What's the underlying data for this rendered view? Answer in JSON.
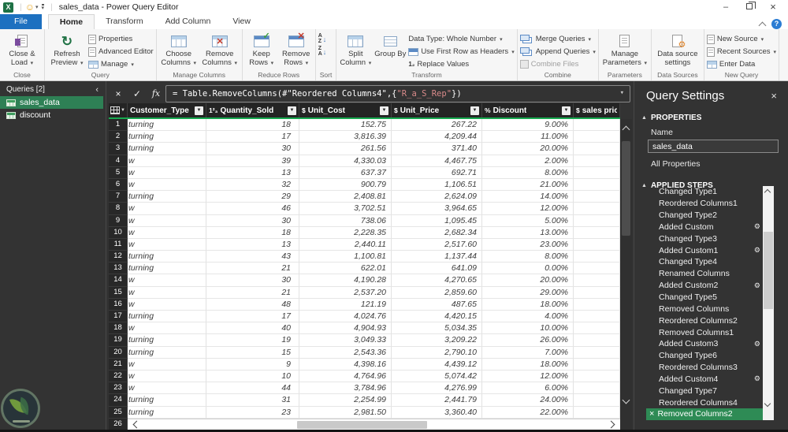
{
  "window": {
    "title": "sales_data - Power Query Editor",
    "excel_logo_letter": "X"
  },
  "icons": {
    "minimize": "–",
    "close": "×",
    "help": "?",
    "smiley": "☺",
    "dropdown": "▾",
    "filter": "▼",
    "cancel": "×",
    "check": "✓",
    "fx": "fx",
    "gear": "⚙",
    "step_delete": "×",
    "queries_collapse": "‹",
    "settings_close": "×",
    "section_triangle": "▲",
    "corner_dropdown": "▼",
    "refresh": "↻",
    "sort_az_letters": "AZ",
    "sort_za_letters": "ZA",
    "sort_arrow": "↓",
    "replace_values_glyph": "1₂"
  },
  "tabs": {
    "file": "File",
    "items": [
      "Home",
      "Transform",
      "Add Column",
      "View"
    ],
    "active": "Home"
  },
  "ribbon": {
    "close_load": "Close & Load",
    "refresh_preview": "Refresh Preview",
    "properties": "Properties",
    "advanced_editor": "Advanced Editor",
    "manage": "Manage",
    "choose_columns": "Choose Columns",
    "remove_columns": "Remove Columns",
    "keep_rows": "Keep Rows",
    "remove_rows": "Remove Rows",
    "split_column": "Split Column",
    "group_by": "Group By",
    "data_type": "Data Type: Whole Number",
    "first_row_headers": "Use First Row as Headers",
    "replace_values": "Replace Values",
    "merge_queries": "Merge Queries",
    "append_queries": "Append Queries",
    "combine_files": "Combine Files",
    "manage_parameters": "Manage Parameters",
    "data_source_settings": "Data source settings",
    "new_source": "New Source",
    "recent_sources": "Recent Sources",
    "enter_data": "Enter Data",
    "group_labels": {
      "close": "Close",
      "query": "Query",
      "manage_columns": "Manage Columns",
      "reduce_rows": "Reduce Rows",
      "sort": "Sort",
      "transform": "Transform",
      "combine": "Combine",
      "parameters": "Parameters",
      "data_sources": "Data Sources",
      "new_query": "New Query"
    }
  },
  "queries": {
    "header": "Queries [2]",
    "items": [
      {
        "name": "sales_data",
        "selected": true
      },
      {
        "name": "discount",
        "selected": false
      }
    ]
  },
  "formula": {
    "part1": "= Table.RemoveColumns(#\"Reordered Columns4\",{",
    "string_part": "\"R_a_S_Rep\"",
    "part2": "})"
  },
  "grid": {
    "columns": [
      {
        "glyph": "",
        "name": "Customer_Type",
        "filter": true
      },
      {
        "glyph": "1²₃",
        "name": "Quantity_Sold",
        "filter": true
      },
      {
        "glyph": "$",
        "name": "Unit_Cost",
        "filter": true
      },
      {
        "glyph": "$",
        "name": "Unit_Price",
        "filter": true
      },
      {
        "glyph": "%",
        "name": "Discount",
        "filter": true
      },
      {
        "glyph": "$",
        "name": "sales price",
        "filter": false
      }
    ],
    "rows": [
      [
        "turning",
        "18",
        "152.75",
        "267.22",
        "9.00%",
        ""
      ],
      [
        "turning",
        "17",
        "3,816.39",
        "4,209.44",
        "11.00%",
        ""
      ],
      [
        "turning",
        "30",
        "261.56",
        "371.40",
        "20.00%",
        ""
      ],
      [
        "w",
        "39",
        "4,330.03",
        "4,467.75",
        "2.00%",
        ""
      ],
      [
        "w",
        "13",
        "637.37",
        "692.71",
        "8.00%",
        ""
      ],
      [
        "w",
        "32",
        "900.79",
        "1,106.51",
        "21.00%",
        ""
      ],
      [
        "turning",
        "29",
        "2,408.81",
        "2,624.09",
        "14.00%",
        ""
      ],
      [
        "w",
        "46",
        "3,702.51",
        "3,964.65",
        "12.00%",
        ""
      ],
      [
        "w",
        "30",
        "738.06",
        "1,095.45",
        "5.00%",
        ""
      ],
      [
        "w",
        "18",
        "2,228.35",
        "2,682.34",
        "13.00%",
        ""
      ],
      [
        "w",
        "13",
        "2,440.11",
        "2,517.60",
        "23.00%",
        ""
      ],
      [
        "turning",
        "43",
        "1,100.81",
        "1,137.44",
        "8.00%",
        ""
      ],
      [
        "turning",
        "21",
        "622.01",
        "641.09",
        "0.00%",
        ""
      ],
      [
        "w",
        "30",
        "4,190.28",
        "4,270.65",
        "20.00%",
        ""
      ],
      [
        "w",
        "21",
        "2,537.20",
        "2,859.60",
        "29.00%",
        ""
      ],
      [
        "w",
        "48",
        "121.19",
        "487.65",
        "18.00%",
        ""
      ],
      [
        "turning",
        "17",
        "4,024.76",
        "4,420.15",
        "4.00%",
        ""
      ],
      [
        "w",
        "40",
        "4,904.93",
        "5,034.35",
        "10.00%",
        ""
      ],
      [
        "turning",
        "19",
        "3,049.33",
        "3,209.22",
        "26.00%",
        ""
      ],
      [
        "turning",
        "15",
        "2,543.36",
        "2,790.10",
        "7.00%",
        ""
      ],
      [
        "w",
        "9",
        "4,398.16",
        "4,439.12",
        "18.00%",
        ""
      ],
      [
        "w",
        "10",
        "4,764.96",
        "5,074.42",
        "12.00%",
        ""
      ],
      [
        "w",
        "44",
        "3,784.96",
        "4,276.99",
        "6.00%",
        ""
      ],
      [
        "turning",
        "31",
        "2,254.99",
        "2,441.79",
        "24.00%",
        ""
      ],
      [
        "turning",
        "23",
        "2,981.50",
        "3,360.40",
        "22.00%",
        ""
      ],
      [
        "",
        "",
        "",
        "",
        "",
        ""
      ]
    ]
  },
  "query_settings": {
    "title": "Query Settings",
    "properties_header": "PROPERTIES",
    "name_label": "Name",
    "name_value": "sales_data",
    "all_properties": "All Properties",
    "steps_header": "APPLIED STEPS",
    "steps": [
      {
        "name": "Changed Type1"
      },
      {
        "name": "Reordered Columns1"
      },
      {
        "name": "Changed Type2"
      },
      {
        "name": "Added Custom",
        "gear": true
      },
      {
        "name": "Changed Type3"
      },
      {
        "name": "Added Custom1",
        "gear": true
      },
      {
        "name": "Changed Type4"
      },
      {
        "name": "Renamed Columns"
      },
      {
        "name": "Added Custom2",
        "gear": true
      },
      {
        "name": "Changed Type5"
      },
      {
        "name": "Removed Columns"
      },
      {
        "name": "Reordered Columns2"
      },
      {
        "name": "Removed Columns1"
      },
      {
        "name": "Added Custom3",
        "gear": true
      },
      {
        "name": "Changed Type6"
      },
      {
        "name": "Reordered Columns3"
      },
      {
        "name": "Added Custom4",
        "gear": true
      },
      {
        "name": "Changed Type7"
      },
      {
        "name": "Reordered Columns4"
      },
      {
        "name": "Removed Columns2",
        "selected": true
      }
    ]
  },
  "colors": {
    "accent_green": "#17a94f",
    "selection_green": "#2e8055",
    "file_tab_blue": "#1d70c0",
    "panel_dark": "#333333"
  }
}
